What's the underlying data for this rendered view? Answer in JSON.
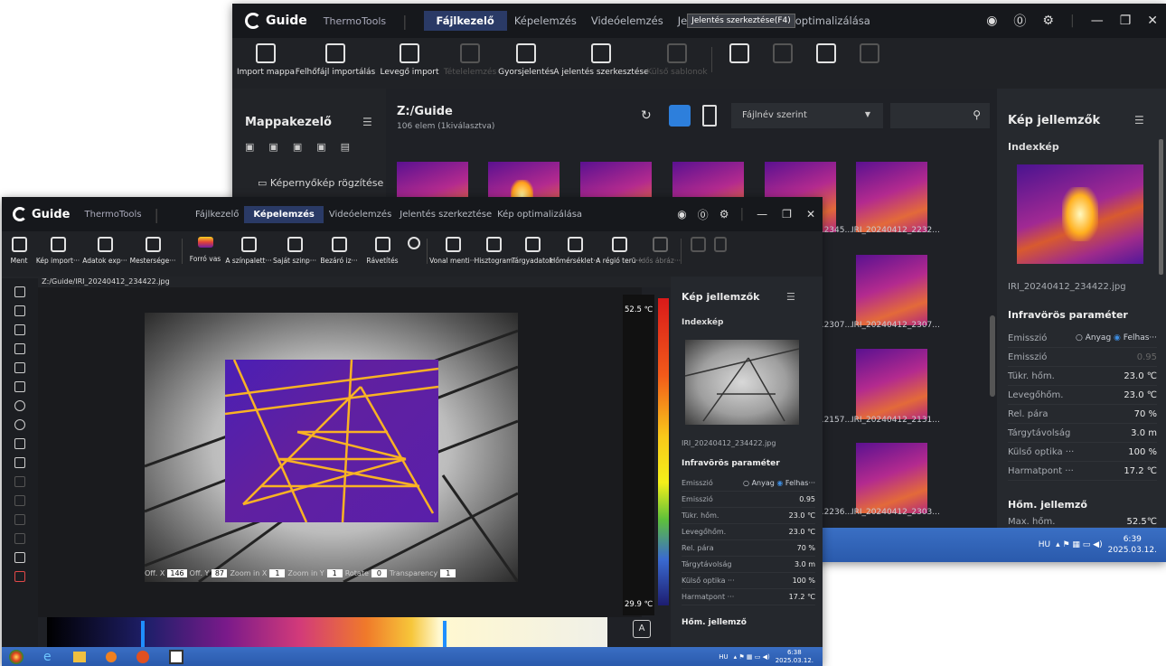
{
  "back": {
    "logo": "Guide",
    "brand": "ThermoTools",
    "menu": [
      "Fájlkezelő",
      "Képelemzés",
      "Videóelemzés",
      "Je",
      "Jelentés szerkeztése(F4)",
      "optimalizálása"
    ],
    "toolbar": [
      {
        "label": "Import mappa",
        "icon": "folder-import-icon",
        "disabled": false
      },
      {
        "label": "Felhőfájl importálás",
        "icon": "cloud-import-icon",
        "disabled": false
      },
      {
        "label": "Levegő import",
        "icon": "download-icon",
        "disabled": false
      },
      {
        "label": "Tételelemzés",
        "icon": "batch-analysis-icon",
        "disabled": true
      },
      {
        "label": "Gyorsjelentés",
        "icon": "quick-report-icon",
        "disabled": false
      },
      {
        "label": "A jelentés szerkesztése",
        "icon": "edit-report-icon",
        "disabled": false
      },
      {
        "label": "Külső sablonok",
        "icon": "word-template-icon",
        "disabled": true
      }
    ],
    "folder_panel": {
      "title": "Mappakezelő",
      "item": "Képernyőkép rögzítése"
    },
    "path": "Z:/Guide",
    "count": "106 elem (1kiválasztva)",
    "sort": "Fájlnév szerint",
    "thumb_captions": [
      "IRI_20240412_2232...",
      "...2345...",
      "IRI_20240412_2307...",
      "...2307...",
      "IRI_20240412_2131...",
      "...2157...",
      "IRI_20240412_2303...",
      "...2236..."
    ],
    "props": {
      "title": "Kép jellemzők",
      "index_label": "Indexkép",
      "filename": "IRI_20240412_234422.jpg",
      "ir_title": "Infravörös paraméter",
      "emission_label": "Emisszió",
      "opt1": "Anyag",
      "opt2": "Felhas···",
      "rows": [
        {
          "k": "Emisszió",
          "v": "0.95"
        },
        {
          "k": "Tükr. hőm.",
          "v": "23.0 ℃"
        },
        {
          "k": "Levegőhőm.",
          "v": "23.0 ℃"
        },
        {
          "k": "Rel. pára",
          "v": "70 %"
        },
        {
          "k": "Tárgytávolság",
          "v": "3.0 m"
        },
        {
          "k": "Külső optika ···",
          "v": "100 %"
        },
        {
          "k": "Harmatpont ···",
          "v": "17.2 ℃"
        }
      ],
      "heat_title": "Hőm. jellemző",
      "heat_row_k": "Max. hőm.",
      "heat_row_v": "52.5℃"
    },
    "tray": {
      "lang": "HU",
      "time": "6:39",
      "date": "2025.03.12."
    }
  },
  "front": {
    "logo": "Guide",
    "brand": "ThermoTools",
    "menu": [
      "Fájlkezelő",
      "Képelemzés",
      "Videóelemzés",
      "Jelentés szerkeztése",
      "Kép optimalizálása"
    ],
    "toolbar": [
      "Ment",
      "Kép import···",
      "Adatok exp···",
      "Mestersége···",
      "Forró vas",
      "A színpalett···",
      "Saját szinp···",
      "Bezáró iz···",
      "Rávetítés",
      "Vonal menti···",
      "Hisztogram",
      "Tárgyadatok",
      "Hőmérséklet···",
      "A régió terü···",
      "Idős ábráz···"
    ],
    "path": "Z:/Guide/IRI_20240412_234422.jpg",
    "scale_max": "52.5 ℃",
    "scale_min": "29.9 ℃",
    "ctrl": {
      "offx_label": "Off. X",
      "offx": "146",
      "offy_label": "Off. Y",
      "offy": "87",
      "zoomx_label": "Zoom in X",
      "zoomx": "1",
      "zoomy_label": "Zoom in Y",
      "zoomy": "1",
      "rotate_label": "Rotate",
      "rotate": "0",
      "trans_label": "Transparency",
      "trans": "1"
    },
    "props": {
      "title": "Kép jellemzők",
      "index_label": "Indexkép",
      "filename": "IRI_20240412_234422.jpg",
      "ir_title": "Infravörös paraméter",
      "emission_label": "Emisszió",
      "opt1": "Anyag",
      "opt2": "Felhas···",
      "rows": [
        {
          "k": "Emisszió",
          "v": "0.95"
        },
        {
          "k": "Tükr. hőm.",
          "v": "23.0 ℃"
        },
        {
          "k": "Levegőhőm.",
          "v": "23.0 ℃"
        },
        {
          "k": "Rel. pára",
          "v": "70 %"
        },
        {
          "k": "Tárgytávolság",
          "v": "3.0 m"
        },
        {
          "k": "Külső optika ···",
          "v": "100 %"
        },
        {
          "k": "Harmatpont ···",
          "v": "17.2 ℃"
        }
      ],
      "heat_title": "Hőm. jellemző"
    },
    "a_button": "A",
    "tray": {
      "lang": "HU",
      "time": "6:38",
      "date": "2025.03.12."
    }
  }
}
